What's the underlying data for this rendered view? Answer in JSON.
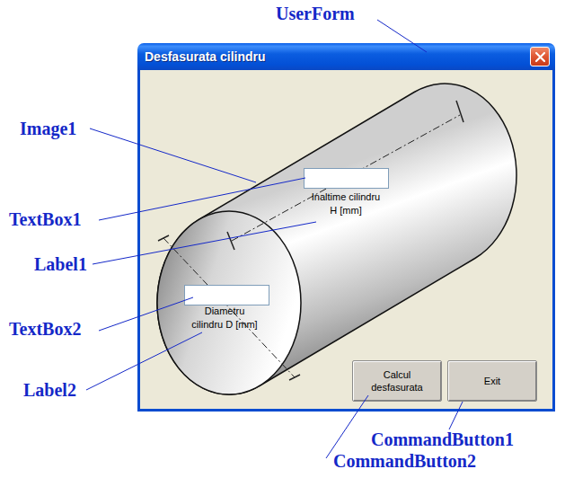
{
  "annotations": [
    {
      "label": "UserForm"
    },
    {
      "label": "Image1"
    },
    {
      "label": "TextBox1"
    },
    {
      "label": "Label1"
    },
    {
      "label": "TextBox2"
    },
    {
      "label": "Label2"
    },
    {
      "label": "CommandButton1"
    },
    {
      "label": "CommandButton2"
    }
  ],
  "window": {
    "title": "Desfasurata cilindru"
  },
  "fields": [
    {
      "label": "Inaltime cilindru H [mm]",
      "value": ""
    },
    {
      "label": "Diametru cilindru D [mm]",
      "value": ""
    }
  ],
  "buttons": [
    "Calcul desfasurata",
    "Exit"
  ]
}
